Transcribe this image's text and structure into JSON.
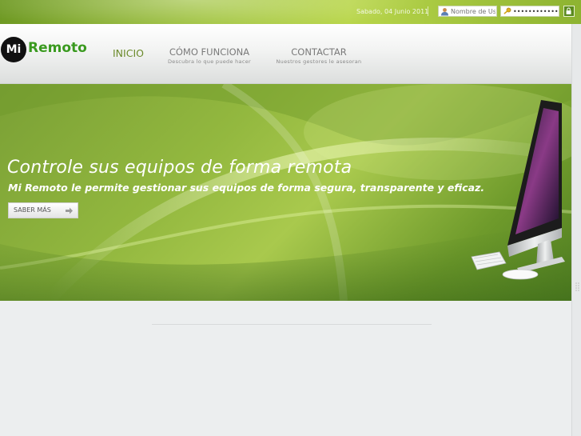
{
  "topbar": {
    "date": "Sabado, 04 Junio 2011",
    "username_placeholder": "Nombre de Usuario",
    "password_value": "••••••••••••"
  },
  "brand": {
    "logo_mi": "Mi",
    "logo_remoto": "Remoto"
  },
  "nav": {
    "inicio": "INICIO",
    "como_funciona": "CÓMO FUNCIONA",
    "como_funciona_sub": "Descubra lo que puede hacer",
    "contactar": "CONTACTAR",
    "contactar_sub": "Nuestros gestores le asesoran"
  },
  "hero": {
    "title": "Controle sus equipos de forma remota",
    "subtitle": "Mi Remoto le permite gestionar sus equipos de forma segura, transparente y eficaz.",
    "button_label": "SABER MÁS"
  },
  "colors": {
    "accent_green": "#3a9a1f",
    "hero_green": "#93b83f",
    "topbar_green": "#9ec23a"
  },
  "icons": [
    "user-icon",
    "key-icon",
    "lock-icon",
    "arrow-right-icon",
    "mi-logo-icon"
  ]
}
